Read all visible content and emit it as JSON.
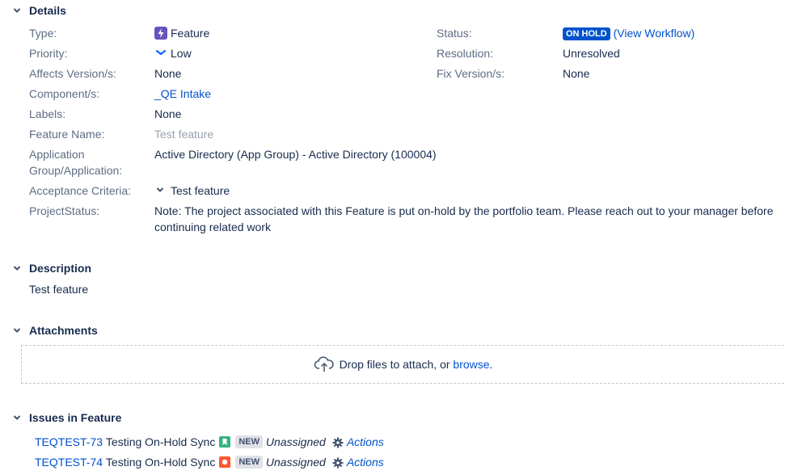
{
  "details": {
    "title": "Details",
    "left_fields": [
      {
        "label": "Type:",
        "value": "Feature"
      },
      {
        "label": "Priority:",
        "value": "Low"
      },
      {
        "label": "Affects Version/s:",
        "value": "None"
      },
      {
        "label": "Component/s:",
        "value": "_QE Intake"
      },
      {
        "label": "Labels:",
        "value": "None"
      },
      {
        "label": "Feature Name:",
        "value": "Test feature"
      },
      {
        "label_line1": "Application",
        "label_line2": "Group/Application:",
        "value": "Active Directory (App Group) - Active Directory (100004)"
      },
      {
        "label": "Acceptance Criteria:",
        "value": "Test feature"
      },
      {
        "label": "ProjectStatus:",
        "value_line1": "Note: The project associated with this Feature is put on-hold by the portfolio team. Please reach out to your manager before",
        "value_line2": "continuing related work"
      }
    ],
    "right_fields": [
      {
        "label": "Status:",
        "badge": "ON HOLD",
        "link": "(View Workflow)"
      },
      {
        "label": "Resolution:",
        "value": "Unresolved"
      },
      {
        "label": "Fix Version/s:",
        "value": "None"
      }
    ]
  },
  "description": {
    "title": "Description",
    "text": "Test feature"
  },
  "attachments": {
    "title": "Attachments",
    "drop_text": "Drop files to attach, or",
    "browse_link": "browse",
    "period": "."
  },
  "issues": {
    "title": "Issues in Feature",
    "rows": [
      {
        "key": "TEQTEST-73",
        "summary": "Testing On-Hold Sync",
        "type_icon": "story-icon",
        "status": "NEW",
        "assignee": "Unassigned",
        "actions": "Actions"
      },
      {
        "key": "TEQTEST-74",
        "summary": "Testing On-Hold Sync",
        "type_icon": "bug-icon",
        "status": "NEW",
        "assignee": "Unassigned",
        "actions": "Actions"
      }
    ]
  },
  "colors": {
    "link": "#0052cc",
    "label": "#5e6c84",
    "on_hold": "#0052cc",
    "feature_icon": "#6554c0",
    "story_icon": "#36b37e",
    "bug_icon": "#ff5630"
  }
}
